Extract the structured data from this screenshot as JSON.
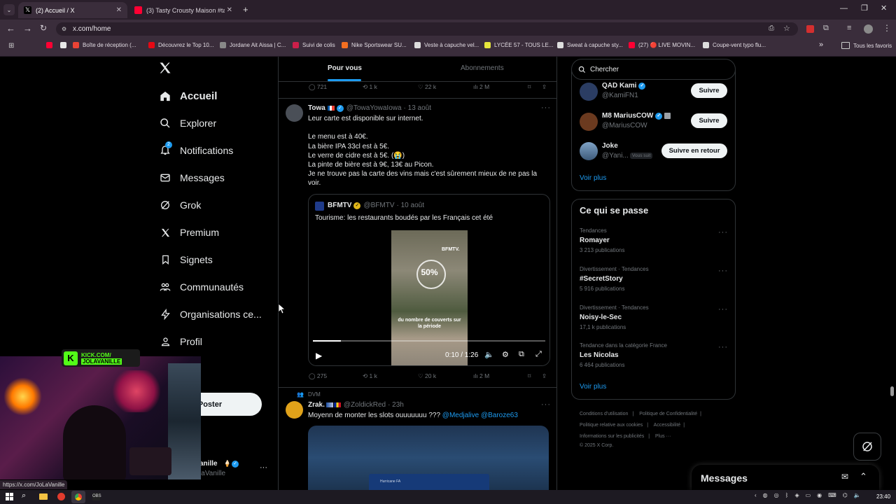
{
  "browser": {
    "tabs": [
      {
        "label": "(2) Accueil / X",
        "favicon_color": "#ffffff"
      },
      {
        "label": "(3) Tasty Crousty Maison #tasty",
        "favicon_color": "#ff0033"
      }
    ],
    "url": "x.com/home",
    "bookmarks": [
      {
        "label": "",
        "color": "#ff0033"
      },
      {
        "label": "",
        "color": "#e8e8e8"
      },
      {
        "label": "Boîte de réception (...",
        "color": "#ea4335"
      },
      {
        "label": "Découvrez le Top 10...",
        "color": "#e50914"
      },
      {
        "label": "Jordane Ait Aissa | C...",
        "color": "#888888"
      },
      {
        "label": "Suivi de colis",
        "color": "#cc1f4a"
      },
      {
        "label": "Nike Sportswear SU...",
        "color": "#f36f21"
      },
      {
        "label": "Veste à capuche vel...",
        "color": "#dddddd"
      },
      {
        "label": "LYCÉE 57 - TOUS LE...",
        "color": "#e6e63c"
      },
      {
        "label": "Sweat à capuche sty...",
        "color": "#dddddd"
      },
      {
        "label": "(27) 🔴 LIVE MOVIN...",
        "color": "#ff0033"
      },
      {
        "label": "Coupe-vent typo flu...",
        "color": "#dddddd"
      }
    ],
    "bookmarks_overflow": "»",
    "all_favorites": "Tous les favoris",
    "status_url": "https://x.com/JoLaVanille"
  },
  "nav": {
    "items": [
      {
        "label": "Accueil",
        "icon": "home-icon"
      },
      {
        "label": "Explorer",
        "icon": "search-icon"
      },
      {
        "label": "Notifications",
        "icon": "bell-icon",
        "badge": "2"
      },
      {
        "label": "Messages",
        "icon": "mail-icon"
      },
      {
        "label": "Grok",
        "icon": "grok-icon"
      },
      {
        "label": "Premium",
        "icon": "x-logo-icon"
      },
      {
        "label": "Signets",
        "icon": "bookmark-icon"
      },
      {
        "label": "Communautés",
        "icon": "communities-icon"
      },
      {
        "label": "Organisations ce...",
        "icon": "lightning-icon"
      },
      {
        "label": "Profil",
        "icon": "person-icon"
      }
    ],
    "post_button": "Poster",
    "profile": {
      "name": "JoLaVanille",
      "name_visible": "anille",
      "handle": "@JoLaVanille"
    }
  },
  "stream_overlay": {
    "badge_top": "KICK.COM/",
    "badge_bottom": "JOLAVANILLE"
  },
  "feed": {
    "tabs": [
      "Pour vous",
      "Abonnements"
    ],
    "prev_actions": {
      "replies": "721",
      "reposts": "1 k",
      "likes": "22 k",
      "views": "2 M"
    },
    "tweet1": {
      "name": "Towa",
      "handle": "@TowaYowaIowa",
      "date": "· 13 août",
      "lines": [
        "Leur carte est disponible sur internet.",
        "",
        "Le menu est à 40€.",
        "La bière IPA 33cl est à 5€.",
        "Le verre de cidre est à 5€. (😭)",
        "La pinte de bière est à 9€, 13€ au Picon.",
        "Je ne trouve pas la carte des vins mais c'est sûrement mieux de ne pas la voir."
      ],
      "quote": {
        "name": "BFMTV",
        "handle": "@BFMTV",
        "date": "· 10 août",
        "text": "Tourisme: les restaurants boudés par les Français cet été",
        "video_overlay_brand": "BFMTV.",
        "video_overlay_pct": "50%",
        "video_overlay_caption": "du nombre de couverts sur la période",
        "time": "0:10 / 1:26",
        "progress": 0.12
      },
      "actions": {
        "replies": "275",
        "reposts": "1 k",
        "likes": "20 k",
        "views": "2 M"
      }
    },
    "tweet2": {
      "context": "DVM",
      "name": "Zrak.",
      "handle": "@ZoldickRed",
      "date": "· 23h",
      "text": "Moyenn de monter les slots ouuuuuuu ??? ",
      "mentions": "@Medjalive @Baroze63",
      "media_label": "Hurricane FA"
    }
  },
  "sidebar": {
    "search_placeholder": "Chercher",
    "who_to_follow": [
      {
        "name": "QAD Kami",
        "handle": "@KamiFN1",
        "button": "Suivre"
      },
      {
        "name": "M8 MariusCOW",
        "handle": "@MariusCOW",
        "button": "Suivre"
      },
      {
        "name": "Joke",
        "handle": "@Yani...",
        "badge": "Vous suit",
        "button": "Suivre en retour"
      }
    ],
    "see_more_1": "Voir plus",
    "trends_title": "Ce qui se passe",
    "trends": [
      {
        "meta": "Tendances",
        "name": "Romayer",
        "count": "3 213 publications"
      },
      {
        "meta": "Divertissement · Tendances",
        "name": "#SecretStory",
        "count": "5 916 publications"
      },
      {
        "meta": "Divertissement · Tendances",
        "name": "Noisy-le-Sec",
        "count": "17,1 k publications"
      },
      {
        "meta": "Tendance dans la catégorie France",
        "name": "Les Nicolas",
        "count": "6 464 publications"
      }
    ],
    "see_more_2": "Voir plus",
    "footer": {
      "links": [
        "Conditions d'utilisation",
        "Politique de Confidentialité",
        "Politique relative aux cookies",
        "Accessibilité",
        "Informations sur les publicités",
        "Plus ···"
      ],
      "copyright": "© 2025 X Corp."
    },
    "messages_drawer": "Messages"
  },
  "taskbar": {
    "time": "23:40"
  }
}
